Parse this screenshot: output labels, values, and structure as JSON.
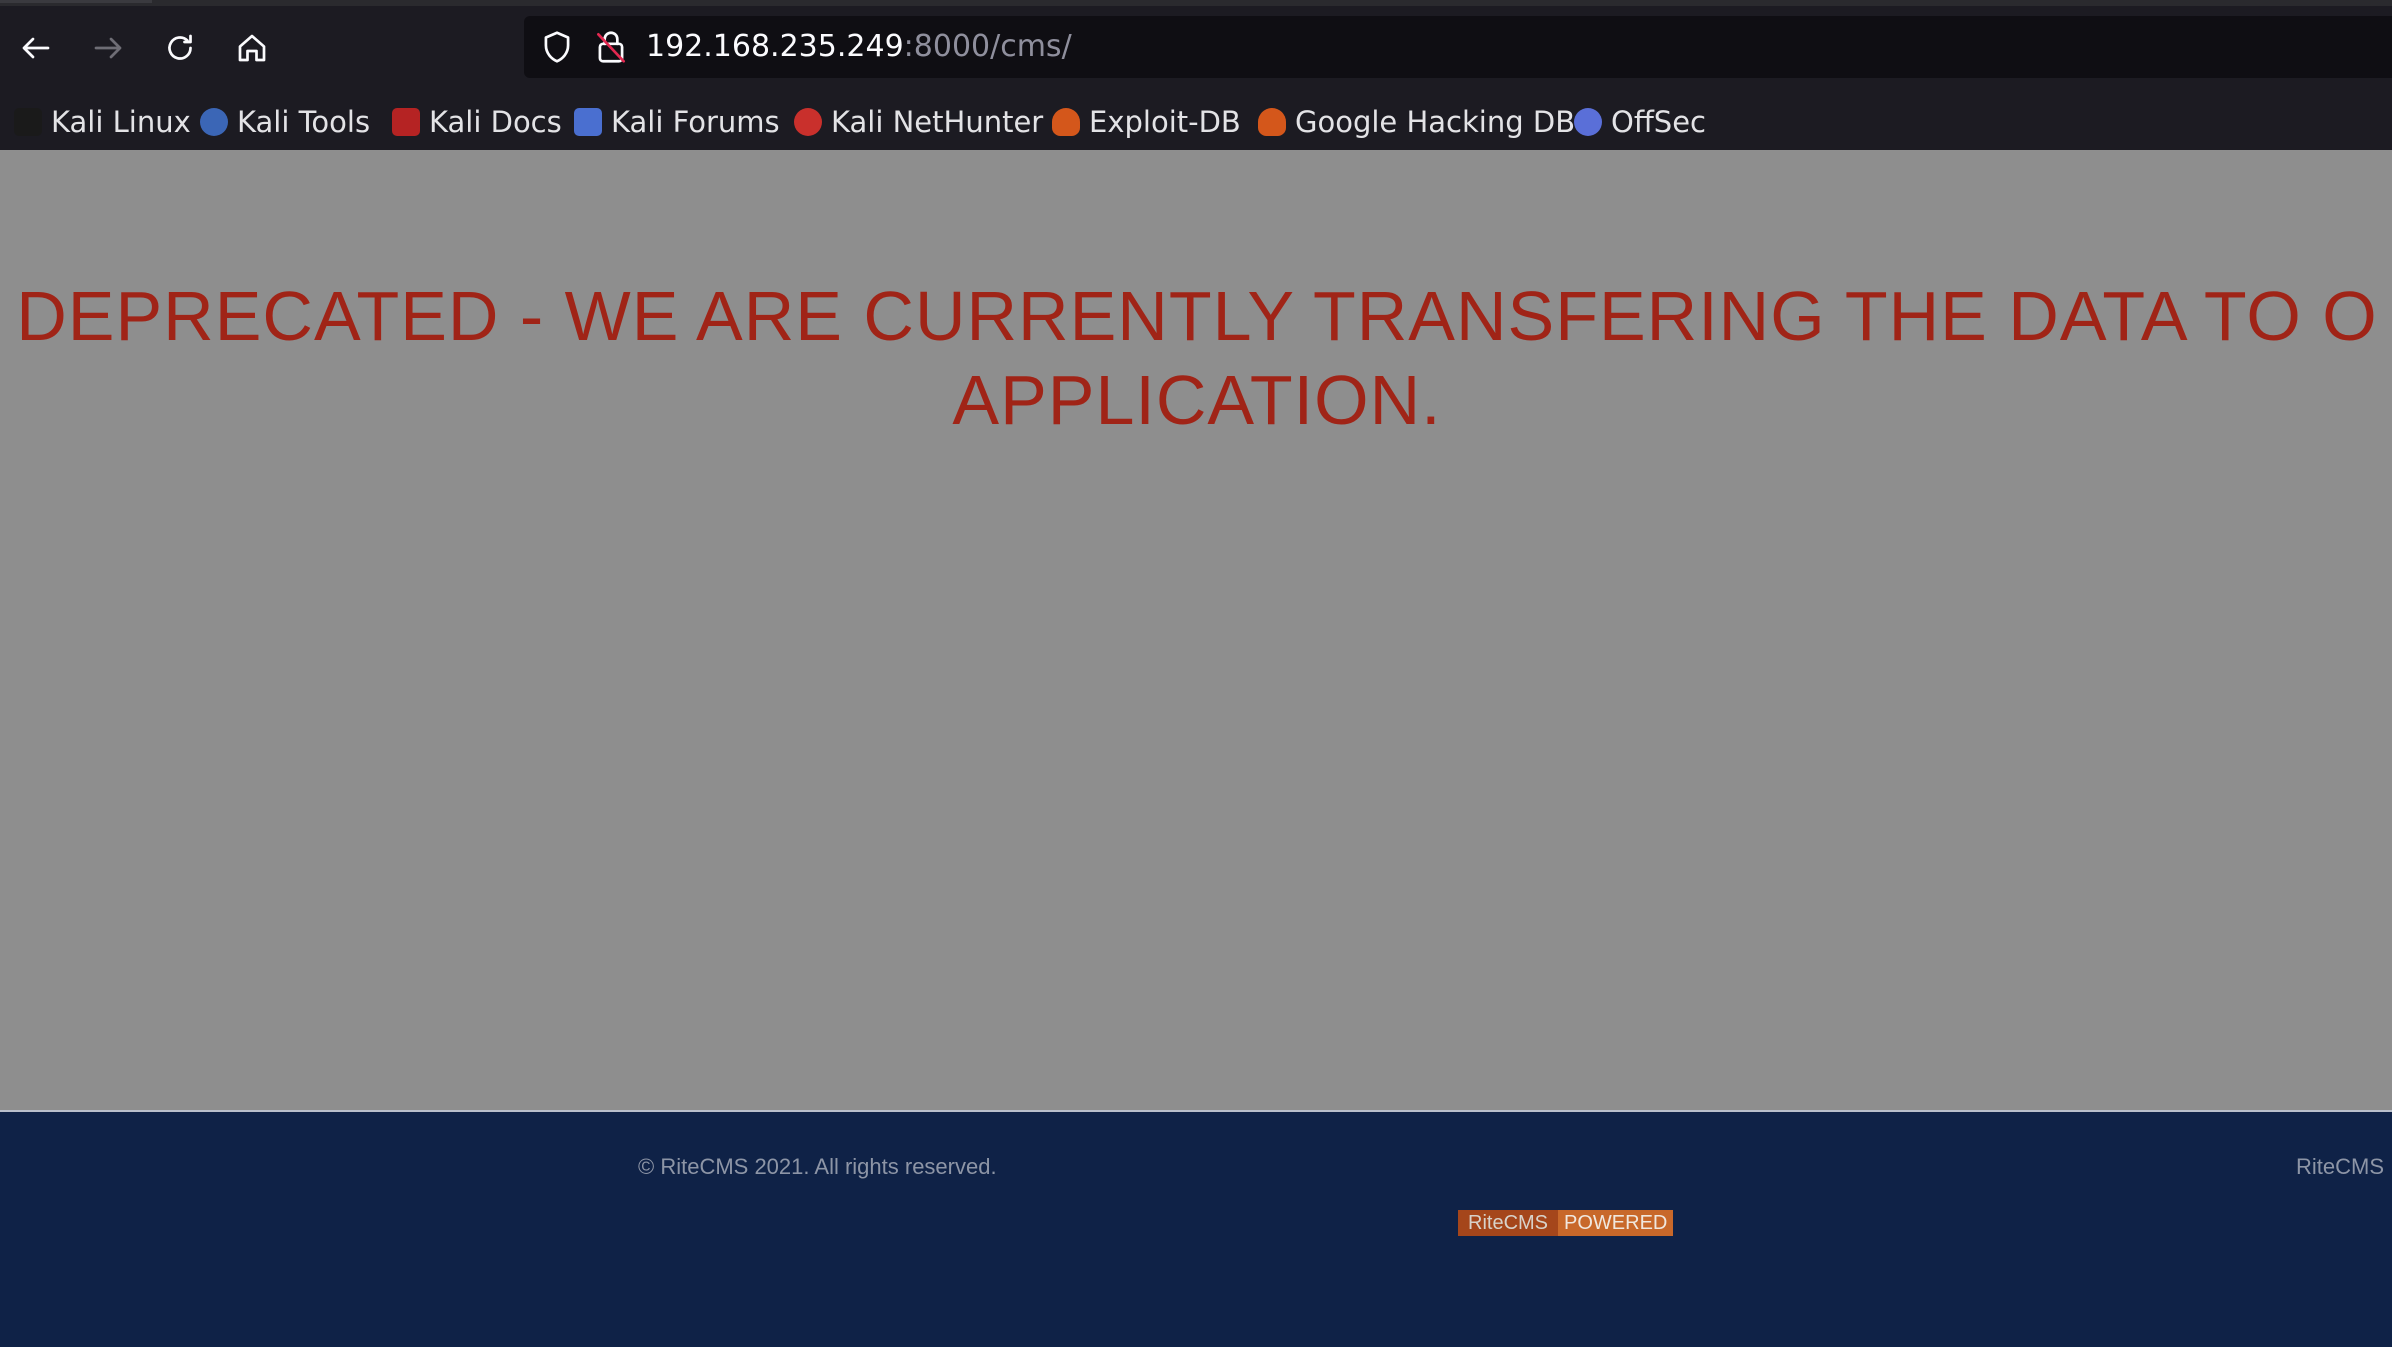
{
  "browser": {
    "url_host": "192.168.235.249",
    "url_rest": ":8000/cms/",
    "bookmarks": [
      {
        "label": "Kali Linux",
        "icon": "kali-dragon-icon",
        "color": "#1a1a1a"
      },
      {
        "label": "Kali Tools",
        "icon": "kali-tools-icon",
        "color": "#3b66b6"
      },
      {
        "label": "Kali Docs",
        "icon": "kali-docs-icon",
        "color": "#b52323"
      },
      {
        "label": "Kali Forums",
        "icon": "kali-forums-icon",
        "color": "#4a6fd0"
      },
      {
        "label": "Kali NetHunter",
        "icon": "kali-nethunter-icon",
        "color": "#c9302c"
      },
      {
        "label": "Exploit-DB",
        "icon": "exploit-db-icon",
        "color": "#d4571b"
      },
      {
        "label": "Google Hacking DB",
        "icon": "ghdb-icon",
        "color": "#d4571b"
      },
      {
        "label": "OffSec",
        "icon": "offsec-icon",
        "color": "#5a6fd8"
      }
    ]
  },
  "page": {
    "headline_line1": "DEPRECATED - WE ARE CURRENTLY TRANSFERING THE DATA TO O",
    "headline_line2": "APPLICATION.",
    "footer": {
      "copyright": "© RiteCMS 2021. All rights reserved.",
      "right_text": "RiteCMS",
      "badge_left": "RiteCMS",
      "badge_right": "POWERED"
    }
  },
  "colors": {
    "headline": "#a02417",
    "content_bg": "#8e8e8e",
    "footer_bg": "#0f2247"
  }
}
